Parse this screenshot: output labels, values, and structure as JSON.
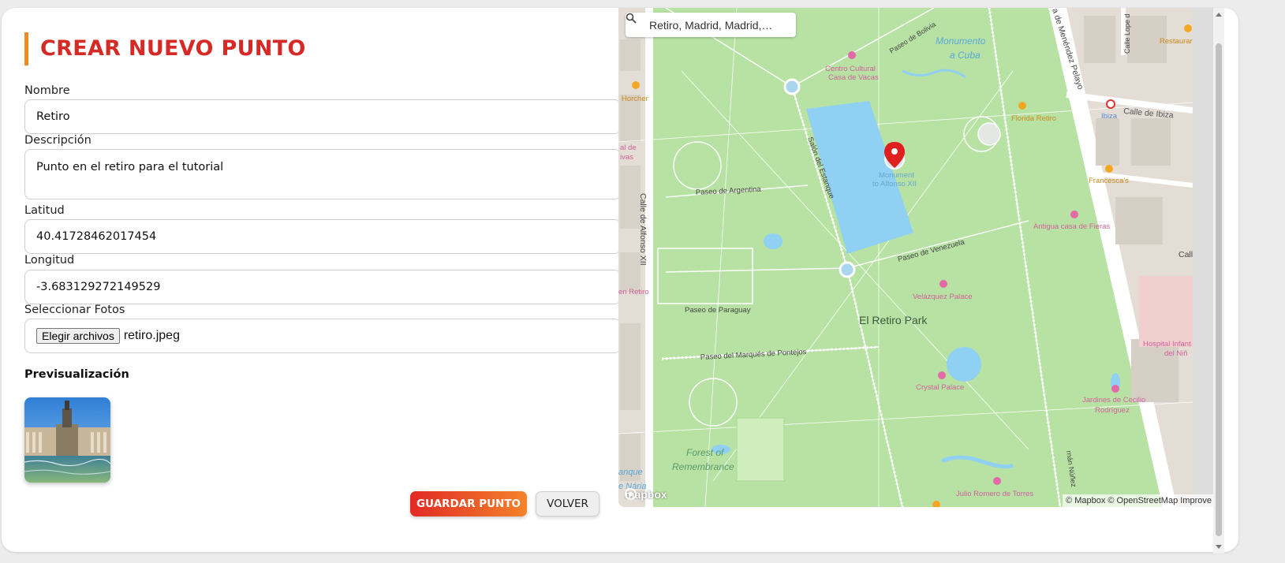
{
  "form": {
    "title": "CREAR NUEVO PUNTO",
    "nombre_label": "Nombre",
    "nombre_value": "Retiro",
    "descripcion_label": "Descripción",
    "descripcion_value": "Punto en el retiro para el tutorial",
    "latitud_label": "Latitud",
    "latitud_value": "40.41728462017454",
    "longitud_label": "Longitud",
    "longitud_value": "-3.683129272149529",
    "fotos_label": "Seleccionar Fotos",
    "file_button": "Elegir archivos",
    "file_name": "retiro.jpeg",
    "preview_title": "Previsualización",
    "save_button": "GUARDAR PUNTO",
    "back_button": "VOLVER"
  },
  "map": {
    "search_value": "Retiro, Madrid, Madrid,…",
    "attribution": "© Mapbox © OpenStreetMap  Improve",
    "logo": "mapbox",
    "labels": {
      "park": "El Retiro Park",
      "monument_line1": "Monument",
      "monument_line2": "to Alfonso XII",
      "monumento_cuba_1": "Monumento",
      "monumento_cuba_2": "a Cuba",
      "centro_cultural_1": "Centro Cultural",
      "centro_cultural_2": "Casa de Vacas",
      "florida_retiro": "Florida Retiro",
      "horcher": "Horcher",
      "ibiza": "Ibiza",
      "calle_ibiza": "Calle de Ibiza",
      "restaurant": "Restaurant",
      "francescas": "Francesca's",
      "antigua": "Antigua casa de Fieras",
      "velazquez": "Velázquez Palace",
      "crystal": "Crystal Palace",
      "jardines_1": "Jardines de Cecilio",
      "jardines_2": "Rodríguez",
      "hospital_1": "Hospital Infant",
      "hospital_2": "del Niñ",
      "forest_1": "Forest of",
      "forest_2": "Remembrance",
      "julio_romero": "Julio Romero de Torres",
      "paseo_argentina": "Paseo de Argentina",
      "paseo_venezuela": "Paseo de Venezuela",
      "paseo_paraguay": "Paseo de Paraguay",
      "paseo_pontejos": "Paseo del Marqués de Pontejos",
      "salon_estanque": "Salón del Estanque",
      "calle_alfonso": "Calle de Alfonso XII",
      "menendez": "a de Menéndez Pelayo",
      "paseo_bolivia": "Paseo de Bolivia",
      "calle_lope": "Calle Lope d",
      "en_retiro": "en Retiro",
      "al_de_1": "al de",
      "al_de_2": "ivas",
      "anque_1": "anque",
      "anque_2": "e Nária",
      "calle_right": "Call",
      "fernan_nunez": "rnán Núñez"
    }
  },
  "colors": {
    "accent": "#d52a26",
    "bar": "#f08a24",
    "park": "#b5e0a0",
    "water": "#8fd0f3",
    "marker": "#e0201f"
  }
}
